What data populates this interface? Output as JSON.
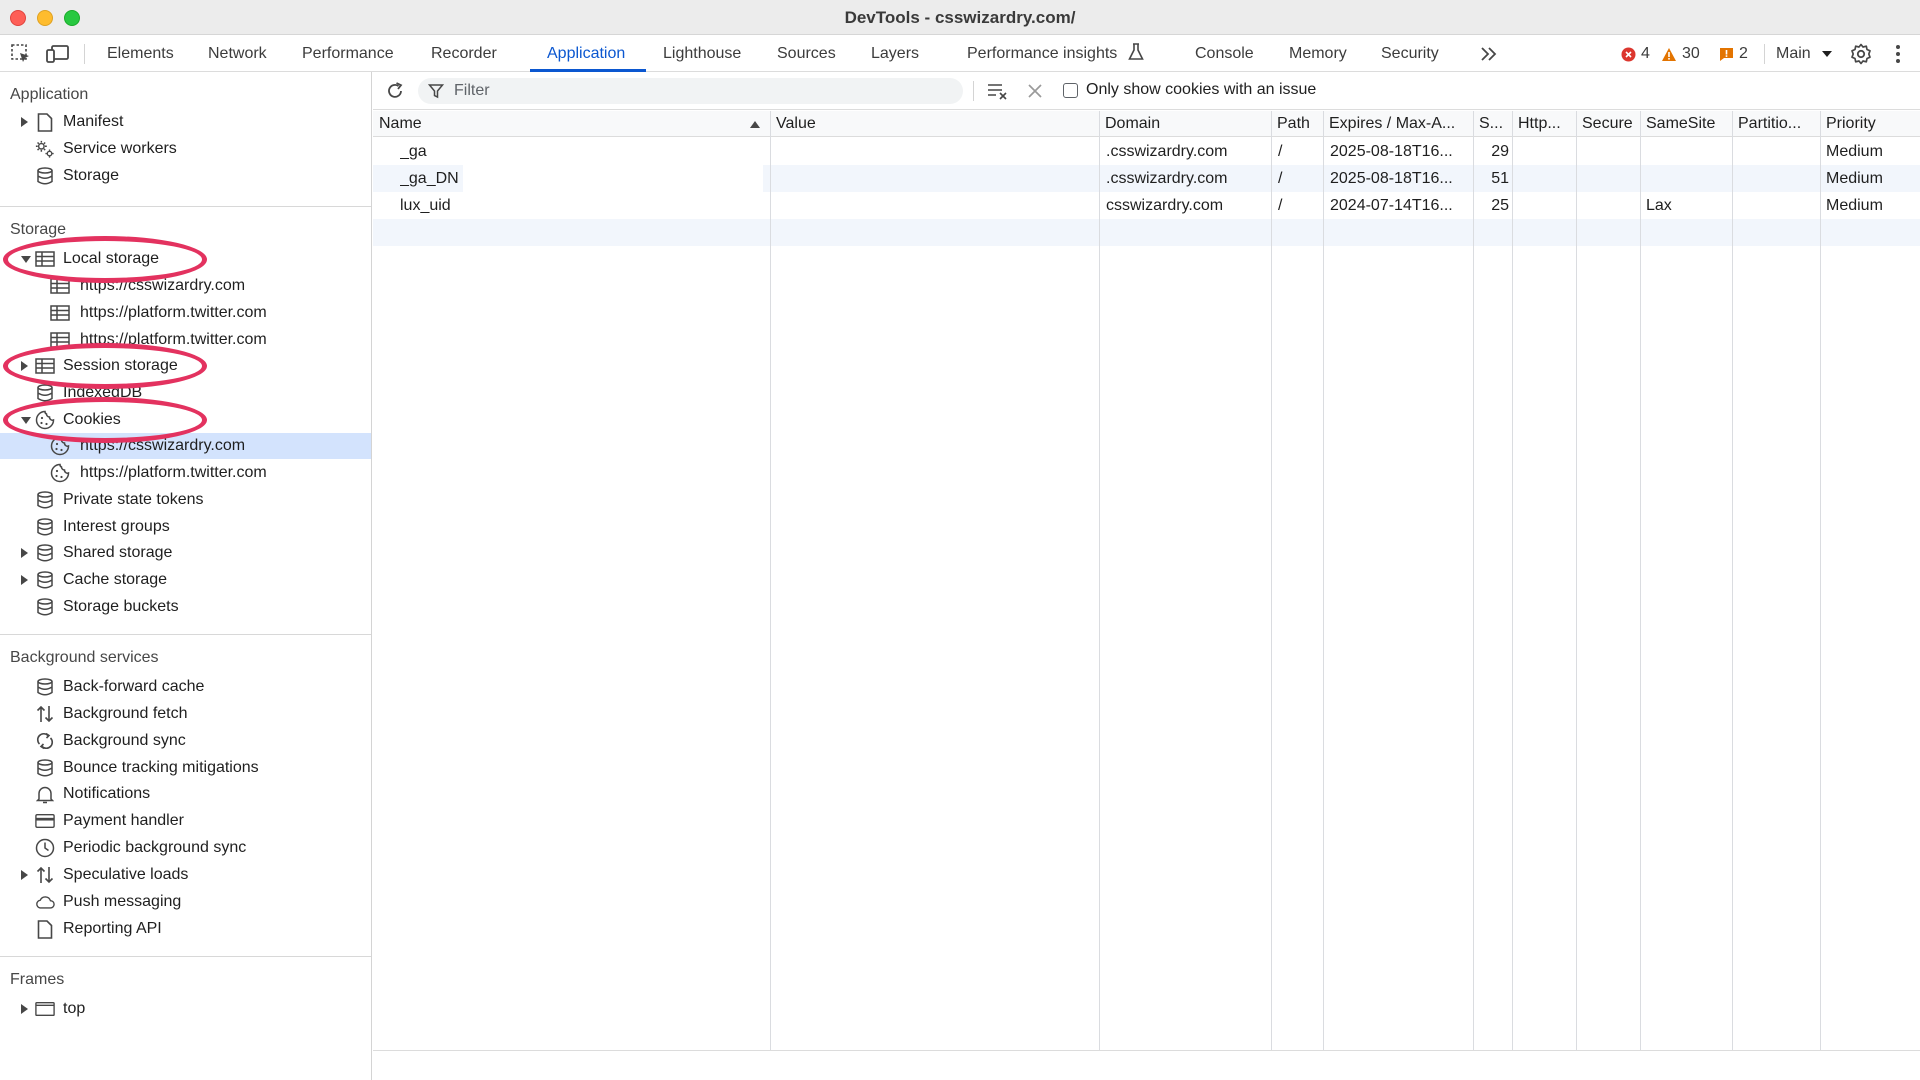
{
  "window": {
    "title": "DevTools - csswizardry.com/"
  },
  "toolbar": {
    "tabs": [
      "Elements",
      "Network",
      "Performance",
      "Recorder",
      "Application",
      "Lighthouse",
      "Sources",
      "Layers",
      "Performance insights",
      "Console",
      "Memory",
      "Security"
    ],
    "active_tab": "Application",
    "more_icon": "chevron-double-right-icon",
    "errors": "4",
    "warnings": "30",
    "issues": "2",
    "context": "Main",
    "colors": {
      "accent": "#0b57d0",
      "error": "#dc362e",
      "warning": "#e37400",
      "issue": "#e37400"
    }
  },
  "sidebar": {
    "application": {
      "heading": "Application",
      "items": [
        "Manifest",
        "Service workers",
        "Storage"
      ]
    },
    "storage": {
      "heading": "Storage",
      "local_storage": "Local storage",
      "local_children": [
        "https://csswizardry.com",
        "https://platform.twitter.com",
        "https://platform.twitter.com"
      ],
      "session_storage": "Session storage",
      "indexeddb": "IndexedDB",
      "cookies": "Cookies",
      "cookie_children": [
        "https://csswizardry.com",
        "https://platform.twitter.com"
      ],
      "selected_cookie": "https://csswizardry.com",
      "rest": [
        "Private state tokens",
        "Interest groups",
        "Shared storage",
        "Cache storage",
        "Storage buckets"
      ]
    },
    "background": {
      "heading": "Background services",
      "items": [
        "Back-forward cache",
        "Background fetch",
        "Background sync",
        "Bounce tracking mitigations",
        "Notifications",
        "Payment handler",
        "Periodic background sync",
        "Speculative loads",
        "Push messaging",
        "Reporting API"
      ]
    },
    "frames": {
      "heading": "Frames",
      "top": "top"
    },
    "annotation_color": "#e3325f"
  },
  "cookies": {
    "filter_placeholder": "Filter",
    "only_issue_label": "Only show cookies with an issue",
    "only_issue_checked": false,
    "columns": [
      "Name",
      "Value",
      "Domain",
      "Path",
      "Expires / Max-A...",
      "S...",
      "Http...",
      "Secure",
      "SameSite",
      "Partitio...",
      "Priority"
    ],
    "sort_column": "Name",
    "sort_direction": "ascending",
    "rows": [
      {
        "name": "_ga",
        "value": "",
        "domain": ".csswizardry.com",
        "path": "/",
        "expires": "2025-08-18T16...",
        "size": "29",
        "httponly": "",
        "secure": "",
        "samesite": "",
        "partition": "",
        "priority": "Medium"
      },
      {
        "name": "_ga_DN",
        "value": "",
        "domain": ".csswizardry.com",
        "path": "/",
        "expires": "2025-08-18T16...",
        "size": "51",
        "httponly": "",
        "secure": "",
        "samesite": "",
        "partition": "",
        "priority": "Medium"
      },
      {
        "name": "lux_uid",
        "value": "",
        "domain": "csswizardry.com",
        "path": "/",
        "expires": "2024-07-14T16...",
        "size": "25",
        "httponly": "",
        "secure": "",
        "samesite": "Lax",
        "partition": "",
        "priority": "Medium"
      }
    ]
  }
}
